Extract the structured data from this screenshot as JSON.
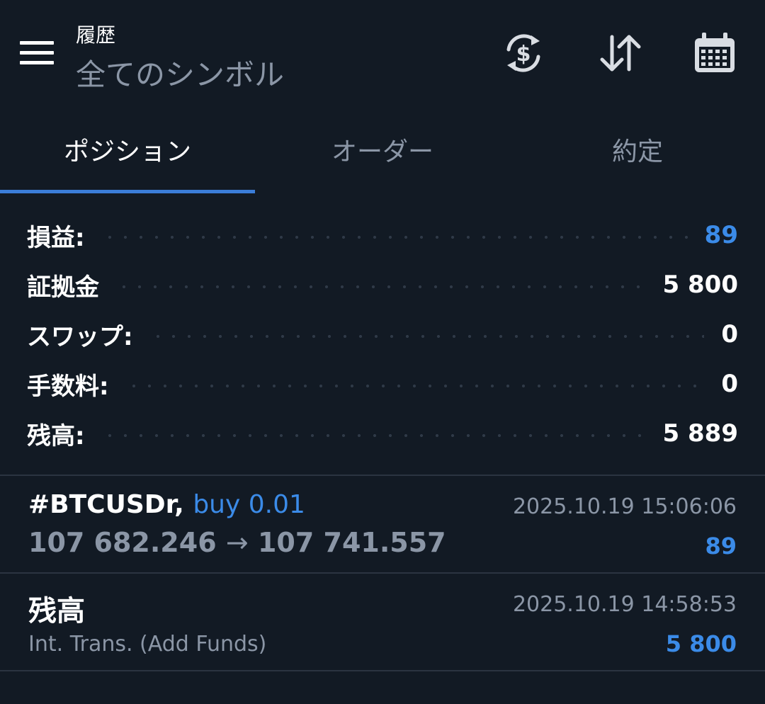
{
  "header": {
    "title_small": "履歴",
    "title_big": "全てのシンボル",
    "icons": [
      "currency-exchange-icon",
      "sort-icon",
      "calendar-icon"
    ]
  },
  "tabs": [
    {
      "label": "ポジション",
      "active": true
    },
    {
      "label": "オーダー",
      "active": false
    },
    {
      "label": "約定",
      "active": false
    }
  ],
  "summary": [
    {
      "label": "損益:",
      "value": "89",
      "color": "#3b8be8"
    },
    {
      "label": "証拠金",
      "value": "5 800",
      "color": "#ffffff"
    },
    {
      "label": "スワップ:",
      "value": "0",
      "color": "#ffffff"
    },
    {
      "label": "手数料:",
      "value": "0",
      "color": "#ffffff"
    },
    {
      "label": "残高:",
      "value": "5 889",
      "color": "#ffffff"
    }
  ],
  "entries": [
    {
      "symbol": "#BTCUSDr,",
      "side": "buy 0.01",
      "datetime": "2025.10.19 15:06:06",
      "open_price": "107 682.246",
      "arrow": "→",
      "close_price": "107 741.557",
      "profit": "89"
    },
    {
      "title": "残高",
      "subtitle": "Int. Trans. (Add Funds)",
      "datetime": "2025.10.19 14:58:53",
      "amount": "5 800"
    }
  ],
  "colors": {
    "background": "#121a24",
    "accent": "#3b8be8",
    "muted": "#8b96a6"
  }
}
